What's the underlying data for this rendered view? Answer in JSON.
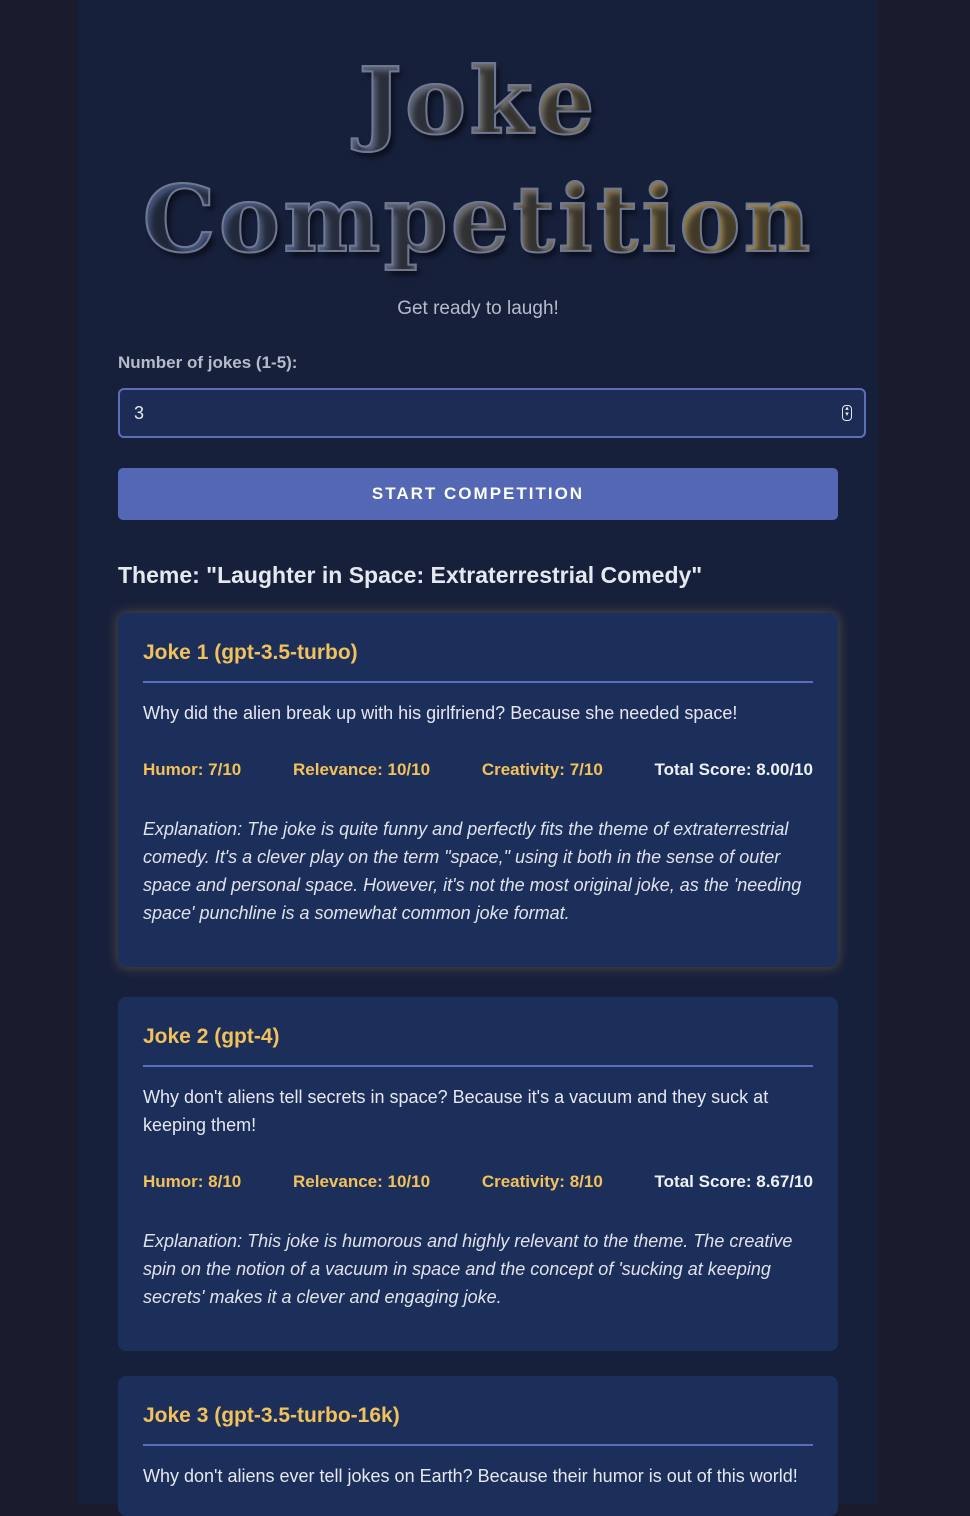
{
  "header": {
    "title_line1": "Joke",
    "title_line2": "Competition",
    "subtitle": "Get ready to laugh!"
  },
  "form": {
    "label": "Number of jokes (1-5):",
    "value": "3",
    "button_label": "START COMPETITION"
  },
  "theme": "Theme: \"Laughter in Space: Extraterrestrial Comedy\"",
  "jokes": [
    {
      "title": "Joke 1 (gpt-3.5-turbo)",
      "text": "Why did the alien break up with his girlfriend? Because she needed space!",
      "humor": "Humor: 7/10",
      "relevance": "Relevance: 10/10",
      "creativity": "Creativity: 7/10",
      "total": "Total Score: 8.00/10",
      "explanation": "Explanation: The joke is quite funny and perfectly fits the theme of extraterrestrial comedy. It's a clever play on the term \"space,\" using it both in the sense of outer space and personal space. However, it's not the most original joke, as the 'needing space' punchline is a somewhat common joke format."
    },
    {
      "title": "Joke 2 (gpt-4)",
      "text": "Why don't aliens tell secrets in space? Because it's a vacuum and they suck at keeping them!",
      "humor": "Humor: 8/10",
      "relevance": "Relevance: 10/10",
      "creativity": "Creativity: 8/10",
      "total": "Total Score: 8.67/10",
      "explanation": "Explanation: This joke is humorous and highly relevant to the theme. The creative spin on the notion of a vacuum in space and the concept of 'sucking at keeping secrets' makes it a clever and engaging joke."
    },
    {
      "title": "Joke 3 (gpt-3.5-turbo-16k)",
      "text": "Why don't aliens ever tell jokes on Earth? Because their humor is out of this world!"
    }
  ],
  "colors": {
    "accent": "#f2c15a",
    "button": "#5367b5",
    "card": "#1c2f5a",
    "panel": "#17203b",
    "page": "#1b1b2e"
  }
}
